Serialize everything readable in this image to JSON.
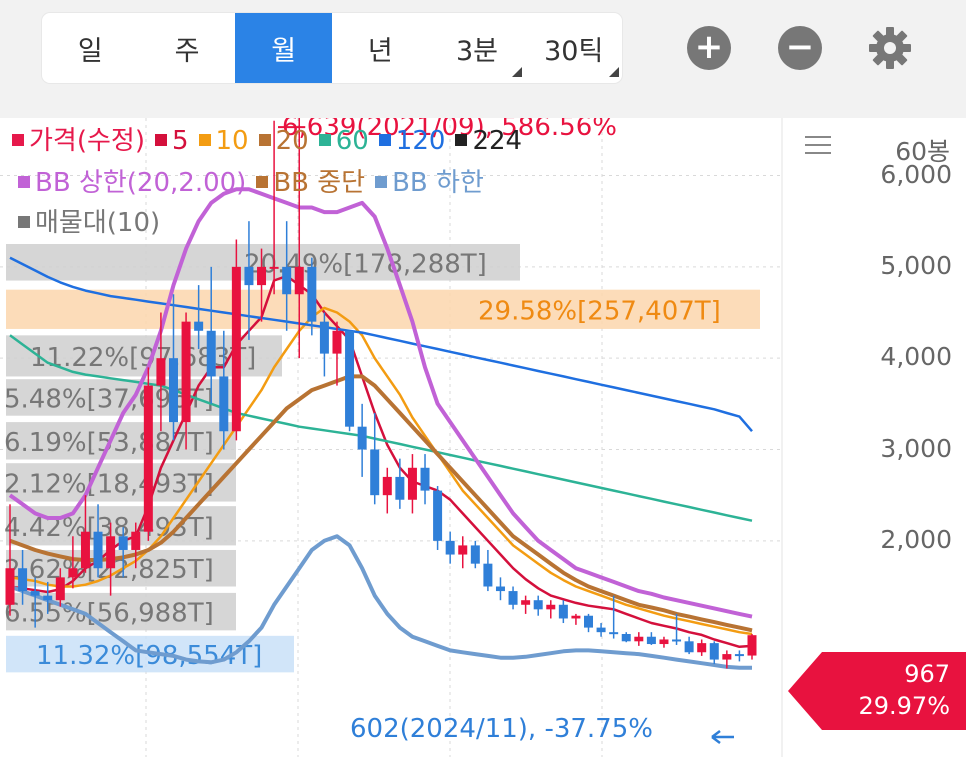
{
  "periods": [
    {
      "label": "일",
      "active": false,
      "dropdown": false
    },
    {
      "label": "주",
      "active": false,
      "dropdown": false
    },
    {
      "label": "월",
      "active": true,
      "dropdown": false
    },
    {
      "label": "년",
      "active": false,
      "dropdown": false
    },
    {
      "label": "3분",
      "active": false,
      "dropdown": true
    },
    {
      "label": "30틱",
      "active": false,
      "dropdown": true
    }
  ],
  "toolbar": {
    "zoom_in_icon": "plus-circle-icon",
    "zoom_out_icon": "minus-circle-icon",
    "settings_icon": "gear-icon"
  },
  "axis": {
    "menu_icon": "hamburger-icon",
    "bars_label": "60봉",
    "ticks": [
      "6,000",
      "5,000",
      "4,000",
      "3,000",
      "2,000"
    ]
  },
  "legend": {
    "row1": [
      {
        "label": "가격(수정)",
        "color": "#e6194b"
      },
      {
        "label": "5",
        "color": "#d4103c"
      },
      {
        "label": "10",
        "color": "#f39c12"
      },
      {
        "label": "20",
        "color": "#b87333"
      },
      {
        "label": "60",
        "color": "#2db396"
      },
      {
        "label": "120",
        "color": "#1f6fe0"
      },
      {
        "label": "224",
        "color": "#222222"
      }
    ],
    "row2": [
      {
        "label": "BB 상한(20,2.00)",
        "color": "#c162d6"
      },
      {
        "label": "BB 중단",
        "color": "#b87333"
      },
      {
        "label": "BB 하한",
        "color": "#6f9ccf"
      }
    ],
    "row3": [
      {
        "label": "매물대(10)",
        "color": "#777777"
      }
    ]
  },
  "price_tag": {
    "price": "967",
    "change": "29.97%",
    "color": "#e8123f"
  },
  "chart_data": {
    "type": "candlestick",
    "interval": "monthly",
    "bar_count": "60봉",
    "y_ticks": [
      2000,
      3000,
      4000,
      5000,
      6000
    ],
    "ylim": [
      470,
      7150
    ],
    "high_marker": {
      "label": "6,639(2021/09), 586.56%",
      "value": 6639
    },
    "low_marker": {
      "label": "602(2024/11), -37.75%",
      "value": 602
    },
    "volume_profile": [
      {
        "label": "20.49%[178,288T]",
        "low": 4850,
        "high": 5250
      },
      {
        "label": "29.58%[257,407T]",
        "low": 4320,
        "high": 4750,
        "highlight": "max"
      },
      {
        "label": "11.22%[97,683T]",
        "low": 3800,
        "high": 4250
      },
      {
        "label": "5.48%[37,696T]",
        "low": 3370,
        "high": 3770
      },
      {
        "label": "6.19%[53,887T]",
        "low": 2890,
        "high": 3300
      },
      {
        "label": "2.12%[18,493T]",
        "low": 2430,
        "high": 2850
      },
      {
        "label": "4.42%[38,493T]",
        "low": 1950,
        "high": 2380
      },
      {
        "label": "2.62%[22,825T]",
        "low": 1500,
        "high": 1900
      },
      {
        "label": "6.55%[56,988T]",
        "low": 1020,
        "high": 1430
      },
      {
        "label": "11.32%[98,554T]",
        "low": 560,
        "high": 960,
        "highlight": "current"
      }
    ],
    "candles": [
      [
        1300,
        2400,
        1180,
        1700
      ],
      [
        1700,
        1900,
        1300,
        1450
      ],
      [
        1450,
        1600,
        1050,
        1400
      ],
      [
        1400,
        1550,
        1200,
        1350
      ],
      [
        1350,
        1700,
        1280,
        1600
      ],
      [
        1600,
        2050,
        1480,
        1700
      ],
      [
        1700,
        2500,
        1650,
        2100
      ],
      [
        2100,
        2400,
        1600,
        1700
      ],
      [
        1700,
        2200,
        1400,
        2050
      ],
      [
        2050,
        2150,
        1600,
        1900
      ],
      [
        1900,
        2200,
        1700,
        2100
      ],
      [
        2100,
        3900,
        2000,
        3700
      ],
      [
        3700,
        4500,
        3200,
        4000
      ],
      [
        4000,
        4700,
        3100,
        3300
      ],
      [
        3300,
        4500,
        3000,
        4400
      ],
      [
        4400,
        4800,
        4100,
        4300
      ],
      [
        4300,
        5000,
        3500,
        3800
      ],
      [
        3800,
        4300,
        3000,
        3200
      ],
      [
        3200,
        5300,
        3100,
        5000
      ],
      [
        5000,
        5500,
        4200,
        4800
      ],
      [
        4800,
        5200,
        4400,
        5000
      ],
      [
        5000,
        6600,
        4700,
        5000
      ],
      [
        5000,
        5500,
        4300,
        4700
      ],
      [
        4700,
        6639,
        4000,
        5000
      ],
      [
        5000,
        5100,
        4250,
        4400
      ],
      [
        4400,
        4500,
        3800,
        4050
      ],
      [
        4050,
        4400,
        3700,
        4300
      ],
      [
        4300,
        4300,
        3200,
        3250
      ],
      [
        3250,
        3500,
        2700,
        3000
      ],
      [
        3000,
        3400,
        2400,
        2500
      ],
      [
        2500,
        2800,
        2300,
        2700
      ],
      [
        2700,
        2900,
        2350,
        2450
      ],
      [
        2450,
        2950,
        2300,
        2800
      ],
      [
        2800,
        2950,
        2400,
        2550
      ],
      [
        2550,
        2600,
        1900,
        2000
      ],
      [
        2000,
        2100,
        1750,
        1850
      ],
      [
        1850,
        2050,
        1700,
        1950
      ],
      [
        1950,
        2000,
        1700,
        1750
      ],
      [
        1750,
        1900,
        1450,
        1500
      ],
      [
        1500,
        1600,
        1350,
        1450
      ],
      [
        1450,
        1500,
        1250,
        1300
      ],
      [
        1300,
        1400,
        1200,
        1350
      ],
      [
        1350,
        1400,
        1180,
        1250
      ],
      [
        1250,
        1350,
        1150,
        1300
      ],
      [
        1300,
        1350,
        1100,
        1150
      ],
      [
        1150,
        1200,
        1080,
        1180
      ],
      [
        1180,
        1200,
        1000,
        1050
      ],
      [
        1050,
        1100,
        950,
        1000
      ],
      [
        1000,
        1400,
        930,
        980
      ],
      [
        980,
        1000,
        890,
        900
      ],
      [
        900,
        1000,
        850,
        950
      ],
      [
        950,
        1000,
        860,
        870
      ],
      [
        870,
        950,
        830,
        920
      ],
      [
        920,
        1200,
        860,
        900
      ],
      [
        900,
        950,
        760,
        780
      ],
      [
        780,
        920,
        740,
        880
      ],
      [
        880,
        900,
        650,
        700
      ],
      [
        700,
        800,
        602,
        760
      ],
      [
        760,
        800,
        680,
        744
      ],
      [
        744,
        980,
        700,
        967
      ]
    ],
    "series": [
      {
        "name": "5",
        "color": "#d4103c",
        "values": [
          1500,
          1480,
          1460,
          1440,
          1470,
          1560,
          1700,
          1780,
          1900,
          2000,
          2050,
          2380,
          2800,
          3100,
          3400,
          3700,
          3900,
          3900,
          4150,
          4300,
          4450,
          4850,
          4900,
          4800,
          4700,
          4500,
          4350,
          4200,
          3800,
          3400,
          3050,
          2800,
          2650,
          2600,
          2550,
          2450,
          2300,
          2150,
          2000,
          1850,
          1700,
          1580,
          1480,
          1400,
          1360,
          1320,
          1290,
          1270,
          1250,
          1200,
          1150,
          1100,
          1070,
          1040,
          1000,
          970,
          920,
          880,
          840,
          850
        ]
      },
      {
        "name": "10",
        "color": "#f39c12",
        "values": [
          1600,
          1580,
          1560,
          1520,
          1500,
          1500,
          1520,
          1560,
          1620,
          1700,
          1780,
          1900,
          2050,
          2250,
          2450,
          2650,
          2850,
          3050,
          3250,
          3450,
          3650,
          3900,
          4100,
          4300,
          4450,
          4550,
          4500,
          4400,
          4250,
          4000,
          3800,
          3600,
          3350,
          3150,
          2950,
          2750,
          2550,
          2400,
          2250,
          2100,
          1950,
          1850,
          1750,
          1650,
          1570,
          1500,
          1450,
          1400,
          1350,
          1300,
          1260,
          1220,
          1180,
          1150,
          1120,
          1090,
          1060,
          1030,
          1000,
          980
        ]
      },
      {
        "name": "20",
        "color": "#b87333",
        "values": [
          2000,
          1950,
          1900,
          1860,
          1830,
          1800,
          1790,
          1790,
          1800,
          1820,
          1850,
          1900,
          1980,
          2100,
          2250,
          2400,
          2550,
          2700,
          2850,
          3000,
          3150,
          3300,
          3450,
          3550,
          3650,
          3700,
          3750,
          3800,
          3800,
          3700,
          3550,
          3400,
          3250,
          3100,
          2950,
          2800,
          2650,
          2500,
          2350,
          2200,
          2050,
          1950,
          1850,
          1750,
          1650,
          1570,
          1500,
          1450,
          1400,
          1350,
          1300,
          1270,
          1240,
          1200,
          1170,
          1140,
          1110,
          1080,
          1050,
          1020
        ]
      },
      {
        "name": "60",
        "color": "#2db396",
        "values": [
          4250,
          4150,
          4050,
          3950,
          3900,
          3850,
          3820,
          3800,
          3780,
          3760,
          3740,
          3720,
          3700,
          3650,
          3600,
          3550,
          3500,
          3450,
          3400,
          3370,
          3340,
          3310,
          3280,
          3250,
          3230,
          3210,
          3190,
          3170,
          3150,
          3120,
          3090,
          3060,
          3030,
          3000,
          2970,
          2940,
          2910,
          2880,
          2850,
          2820,
          2790,
          2760,
          2730,
          2700,
          2670,
          2640,
          2610,
          2580,
          2550,
          2520,
          2490,
          2460,
          2430,
          2400,
          2370,
          2340,
          2310,
          2280,
          2250,
          2220
        ]
      },
      {
        "name": "120",
        "color": "#1f6fe0",
        "values": [
          5100,
          5030,
          4960,
          4890,
          4830,
          4780,
          4740,
          4710,
          4680,
          4660,
          4640,
          4620,
          4600,
          4580,
          4560,
          4540,
          4520,
          4500,
          4480,
          4460,
          4440,
          4420,
          4400,
          4380,
          4360,
          4340,
          4320,
          4300,
          4280,
          4250,
          4220,
          4190,
          4160,
          4130,
          4100,
          4070,
          4040,
          4010,
          3980,
          3950,
          3920,
          3890,
          3860,
          3830,
          3800,
          3770,
          3740,
          3710,
          3680,
          3650,
          3620,
          3590,
          3560,
          3530,
          3500,
          3470,
          3440,
          3400,
          3360,
          3200
        ]
      },
      {
        "name": "BB 상한",
        "color": "#c162d6",
        "values": [
          2500,
          2400,
          2300,
          2250,
          2250,
          2300,
          2500,
          2800,
          3100,
          3400,
          3600,
          3900,
          4300,
          4800,
          5200,
          5500,
          5700,
          5800,
          5850,
          5850,
          5800,
          5750,
          5700,
          5650,
          5650,
          5600,
          5600,
          5650,
          5700,
          5550,
          5200,
          4800,
          4400,
          3900,
          3500,
          3300,
          3100,
          2900,
          2700,
          2500,
          2300,
          2150,
          2000,
          1900,
          1800,
          1700,
          1650,
          1600,
          1550,
          1500,
          1450,
          1420,
          1380,
          1350,
          1320,
          1290,
          1260,
          1230,
          1200,
          1170
        ]
      },
      {
        "name": "BB 중단",
        "color": "#b87333",
        "values": [
          2000,
          1950,
          1900,
          1860,
          1830,
          1800,
          1790,
          1790,
          1800,
          1820,
          1850,
          1900,
          1980,
          2100,
          2250,
          2400,
          2550,
          2700,
          2850,
          3000,
          3150,
          3300,
          3450,
          3550,
          3650,
          3700,
          3750,
          3800,
          3800,
          3700,
          3550,
          3400,
          3250,
          3100,
          2950,
          2800,
          2650,
          2500,
          2350,
          2200,
          2050,
          1950,
          1850,
          1750,
          1650,
          1570,
          1500,
          1450,
          1400,
          1350,
          1300,
          1270,
          1240,
          1200,
          1170,
          1140,
          1110,
          1080,
          1050,
          1020
        ]
      },
      {
        "name": "BB 하한",
        "color": "#6f9ccf",
        "values": [
          1500,
          1450,
          1400,
          1350,
          1300,
          1250,
          1200,
          1100,
          1000,
          900,
          800,
          780,
          760,
          740,
          700,
          680,
          670,
          700,
          780,
          900,
          1050,
          1300,
          1500,
          1700,
          1900,
          2000,
          2050,
          1950,
          1700,
          1400,
          1200,
          1050,
          950,
          900,
          850,
          800,
          780,
          760,
          740,
          720,
          720,
          730,
          750,
          770,
          790,
          800,
          800,
          790,
          780,
          770,
          760,
          740,
          720,
          700,
          680,
          660,
          640,
          620,
          610,
          610
        ]
      }
    ]
  }
}
